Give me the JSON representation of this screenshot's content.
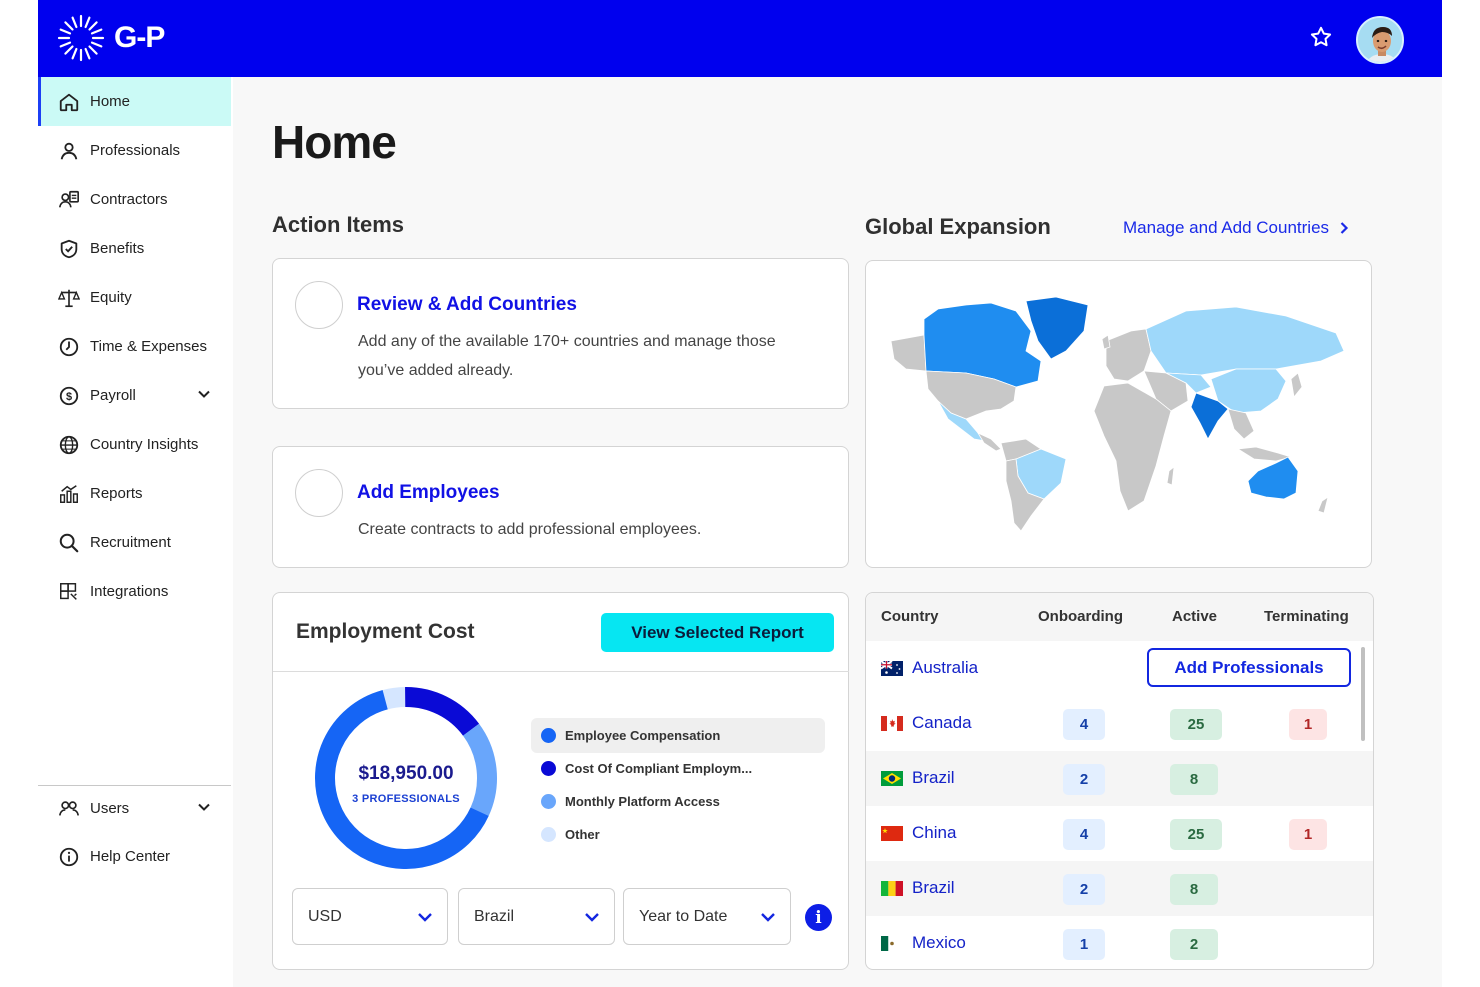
{
  "brand": {
    "logo_text": "G-P"
  },
  "sidebar": {
    "items": [
      {
        "label": "Home",
        "icon": "home-icon"
      },
      {
        "label": "Professionals",
        "icon": "person-icon"
      },
      {
        "label": "Contractors",
        "icon": "contractor-icon"
      },
      {
        "label": "Benefits",
        "icon": "shield-icon"
      },
      {
        "label": "Equity",
        "icon": "scale-icon"
      },
      {
        "label": "Time & Expenses",
        "icon": "clock-icon"
      },
      {
        "label": "Payroll",
        "icon": "dollar-icon"
      },
      {
        "label": "Country Insights",
        "icon": "globe-icon"
      },
      {
        "label": "Reports",
        "icon": "reports-icon"
      },
      {
        "label": "Recruitment",
        "icon": "search-icon"
      },
      {
        "label": "Integrations",
        "icon": "integrations-icon"
      }
    ],
    "bottom": [
      {
        "label": "Users",
        "icon": "users-icon"
      },
      {
        "label": "Help Center",
        "icon": "info-icon"
      }
    ]
  },
  "main": {
    "title": "Home",
    "action_items": {
      "heading": "Action Items",
      "cards": [
        {
          "title": "Review & Add Countries",
          "line1": "Add any of the available 170+ countries and manage those",
          "line2": "you’ve added already."
        },
        {
          "title": "Add Employees",
          "line1": "Create contracts to add professional employees."
        }
      ]
    },
    "global_expansion": {
      "heading": "Global Expansion",
      "manage_link": "Manage and Add Countries"
    },
    "employment_cost": {
      "heading": "Employment Cost",
      "button": "View Selected Report",
      "total": "$18,950.00",
      "professionals": "3 PROFESSIONALS",
      "legend": [
        {
          "label": "Employee Compensation",
          "color": "#1565f5"
        },
        {
          "label": "Cost Of Compliant Employm...",
          "color": "#0a0ad6"
        },
        {
          "label": "Monthly Platform Access",
          "color": "#69a6fb"
        },
        {
          "label": "Other",
          "color": "#d5e6ff"
        }
      ],
      "breakdown_percent": [
        {
          "label": "Employee Compensation",
          "value": 64
        },
        {
          "label": "Cost Of Compliant Employm...",
          "value": 15
        },
        {
          "label": "Monthly Platform Access",
          "value": 17
        },
        {
          "label": "Other",
          "value": 4
        }
      ],
      "filters": {
        "currency": "USD",
        "country": "Brazil",
        "period": "Year to Date"
      }
    },
    "countries_table": {
      "headers": [
        "Country",
        "Onboarding",
        "Active",
        "Terminating"
      ],
      "add_button": "Add Professionals",
      "rows": [
        {
          "country": "Australia",
          "onboarding": "",
          "active": "",
          "terminating": ""
        },
        {
          "country": "Canada",
          "onboarding": "4",
          "active": "25",
          "terminating": "1"
        },
        {
          "country": "Brazil",
          "onboarding": "2",
          "active": "8",
          "terminating": ""
        },
        {
          "country": "China",
          "onboarding": "4",
          "active": "25",
          "terminating": "1"
        },
        {
          "country": "Brazil",
          "onboarding": "2",
          "active": "8",
          "terminating": ""
        },
        {
          "country": "Mexico",
          "onboarding": "1",
          "active": "2",
          "terminating": ""
        }
      ]
    }
  },
  "colors": {
    "topbar": "#0000ee",
    "accent_cyan": "#06e6f2",
    "link_blue": "#1111e5",
    "map_dark": "#0b6fd8",
    "map_mid": "#1f8df0",
    "map_light": "#9ed8fa",
    "map_gray": "#c8c8c8"
  }
}
